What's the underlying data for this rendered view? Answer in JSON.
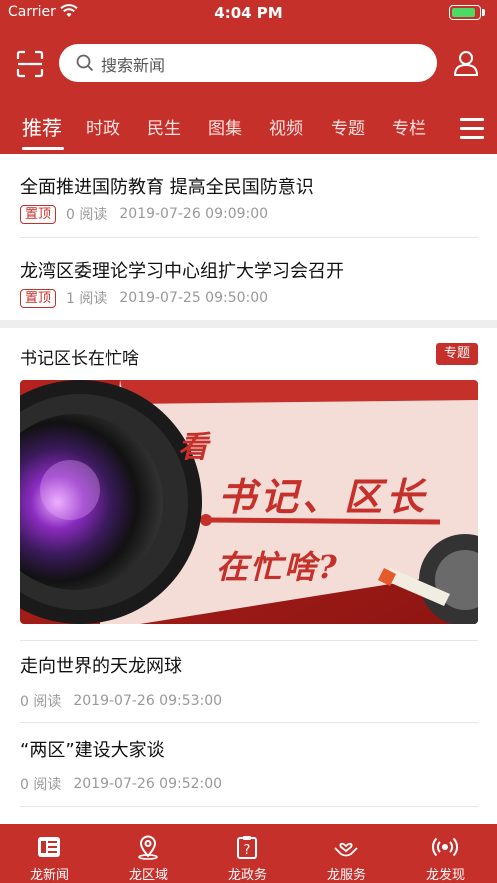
{
  "status_bar": {
    "carrier": "Carrier",
    "time": "4:04 PM",
    "battery_level": 0.9
  },
  "search": {
    "placeholder": "搜索新闻"
  },
  "tabs": [
    "推荐",
    "时政",
    "民生",
    "图集",
    "视频",
    "专题",
    "专栏"
  ],
  "active_tab": "推荐",
  "pinned_news": [
    {
      "title": "全面推进国防教育 提高全民国防意识",
      "badge": "置顶",
      "reads": "0 阅读",
      "time": "2019-07-26 09:09:00"
    },
    {
      "title": "龙湾区委理论学习中心组扩大学习会召开",
      "badge": "置顶",
      "reads": "1 阅读",
      "time": "2019-07-25 09:50:00"
    }
  ],
  "topic": {
    "title": "书记区长在忙啥",
    "badge": "专题",
    "banner_line1": "看",
    "banner_line2": "书记、区长",
    "banner_line3": "在忙啥?"
  },
  "news": [
    {
      "title": "走向世界的天龙网球",
      "reads": "0 阅读",
      "time": "2019-07-26 09:53:00"
    },
    {
      "title": "“两区”建设大家谈",
      "reads": "0 阅读",
      "time": "2019-07-26 09:52:00"
    }
  ],
  "tabbar": [
    {
      "label": "龙新闻",
      "icon": "news-icon"
    },
    {
      "label": "龙区域",
      "icon": "location-pin-icon"
    },
    {
      "label": "龙政务",
      "icon": "clipboard-question-icon"
    },
    {
      "label": "龙服务",
      "icon": "service-hands-icon"
    },
    {
      "label": "龙发现",
      "icon": "broadcast-icon"
    }
  ],
  "colors": {
    "brand": "#c6302b",
    "battery": "#4cd964"
  }
}
